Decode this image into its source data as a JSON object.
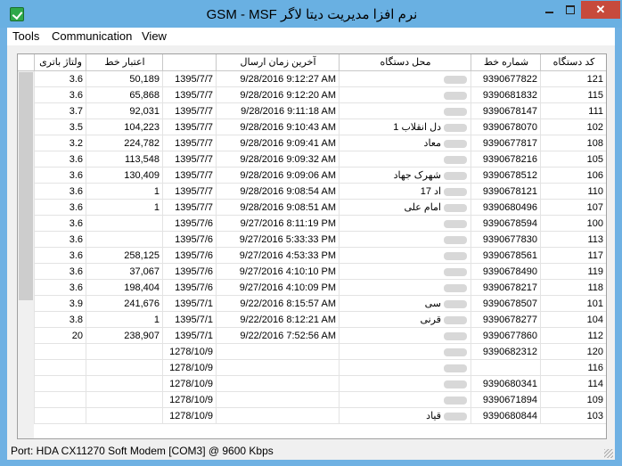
{
  "window": {
    "title": "GSM  - MSF نرم افزا مدیریت دیتا لاگر",
    "min": "–",
    "max": "□",
    "close": "✕"
  },
  "menu": [
    "Tools",
    "Communication",
    "View"
  ],
  "table": {
    "columns": [
      "ولتاژ باتری",
      "اعتبار خط",
      "",
      "آخرین زمان ارسال",
      "محل دستگاه",
      "شماره خط",
      "کد دستگاه"
    ],
    "rows": [
      {
        "voltage": "3.6",
        "credit": "50,189",
        "date": "1395/7/7",
        "time": "9/28/2016 9:12:27 AM",
        "place": "",
        "phone": "9390677822",
        "code": "121",
        "selected": true
      },
      {
        "voltage": "3.6",
        "credit": "65,868",
        "date": "1395/7/7",
        "time": "9/28/2016 9:12:20 AM",
        "place": "",
        "phone": "9390681832",
        "code": "115"
      },
      {
        "voltage": "3.7",
        "credit": "92,031",
        "date": "1395/7/7",
        "time": "9/28/2016 9:11:18 AM",
        "place": "",
        "phone": "9390678147",
        "code": "111"
      },
      {
        "voltage": "3.5",
        "credit": "104,223",
        "date": "1395/7/7",
        "time": "9/28/2016 9:10:43 AM",
        "place": "دل انقلاب 1",
        "phone": "9390678070",
        "code": "102"
      },
      {
        "voltage": "3.2",
        "credit": "224,782",
        "date": "1395/7/7",
        "time": "9/28/2016 9:09:41 AM",
        "place": "معاد",
        "phone": "9390677817",
        "code": "108"
      },
      {
        "voltage": "3.6",
        "credit": "113,548",
        "date": "1395/7/7",
        "time": "9/28/2016 9:09:32 AM",
        "place": "",
        "phone": "9390678216",
        "code": "105"
      },
      {
        "voltage": "3.6",
        "credit": "130,409",
        "date": "1395/7/7",
        "time": "9/28/2016 9:09:06 AM",
        "place": "شهرک جهاد",
        "phone": "9390678512",
        "code": "106"
      },
      {
        "voltage": "3.6",
        "credit": "1",
        "date": "1395/7/7",
        "time": "9/28/2016 9:08:54 AM",
        "place": "اد 17",
        "phone": "9390678121",
        "code": "110"
      },
      {
        "voltage": "3.6",
        "credit": "1",
        "date": "1395/7/7",
        "time": "9/28/2016 9:08:51 AM",
        "place": "امام علی",
        "phone": "9390680496",
        "code": "107"
      },
      {
        "voltage": "3.6",
        "credit": "",
        "date": "1395/7/6",
        "time": "9/27/2016 8:11:19 PM",
        "place": "",
        "phone": "9390678594",
        "code": "100"
      },
      {
        "voltage": "3.6",
        "credit": "",
        "date": "1395/7/6",
        "time": "9/27/2016 5:33:33 PM",
        "place": "",
        "phone": "9390677830",
        "code": "113"
      },
      {
        "voltage": "3.6",
        "credit": "258,125",
        "date": "1395/7/6",
        "time": "9/27/2016 4:53:33 PM",
        "place": "",
        "phone": "9390678561",
        "code": "117"
      },
      {
        "voltage": "3.6",
        "credit": "37,067",
        "date": "1395/7/6",
        "time": "9/27/2016 4:10:10 PM",
        "place": "",
        "phone": "9390678490",
        "code": "119"
      },
      {
        "voltage": "3.6",
        "credit": "198,404",
        "date": "1395/7/6",
        "time": "9/27/2016 4:10:09 PM",
        "place": "",
        "phone": "9390678217",
        "code": "118"
      },
      {
        "voltage": "3.9",
        "credit": "241,676",
        "date": "1395/7/1",
        "time": "9/22/2016 8:15:57 AM",
        "place": "سی",
        "phone": "9390678507",
        "code": "101"
      },
      {
        "voltage": "3.8",
        "credit": "1",
        "date": "1395/7/1",
        "time": "9/22/2016 8:12:21 AM",
        "place": "قرنی",
        "phone": "9390678277",
        "code": "104"
      },
      {
        "voltage": "20",
        "credit": "238,907",
        "date": "1395/7/1",
        "time": "9/22/2016 7:52:56 AM",
        "place": "",
        "phone": "9390677860",
        "code": "112"
      },
      {
        "voltage": "",
        "credit": "",
        "date": "1278/10/9",
        "time": "",
        "place": "",
        "phone": "9390682312",
        "code": "120"
      },
      {
        "voltage": "",
        "credit": "",
        "date": "1278/10/9",
        "time": "",
        "place": "",
        "phone": "",
        "code": "116"
      },
      {
        "voltage": "",
        "credit": "",
        "date": "1278/10/9",
        "time": "",
        "place": "",
        "phone": "9390680341",
        "code": "114"
      },
      {
        "voltage": "",
        "credit": "",
        "date": "1278/10/9",
        "time": "",
        "place": "",
        "phone": "9390671894",
        "code": "109"
      },
      {
        "voltage": "",
        "credit": "",
        "date": "1278/10/9",
        "time": "",
        "place": "قیاد",
        "phone": "9390680844",
        "code": "103"
      }
    ]
  },
  "status": {
    "text": "Port: HDA CX11270 Soft Modem [COM3] @ 9600 Kbps"
  }
}
